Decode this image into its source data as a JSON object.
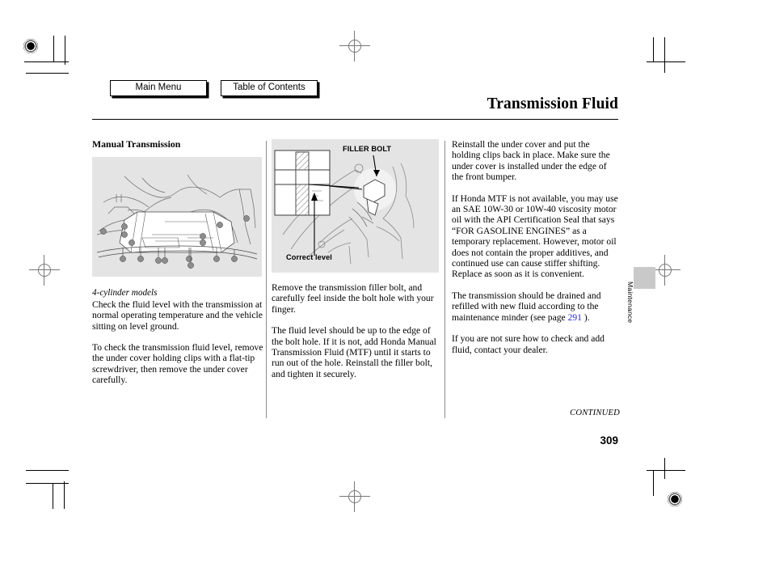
{
  "nav": {
    "main_menu": "Main Menu",
    "table_of_contents": "Table of Contents"
  },
  "header": {
    "title": "Transmission Fluid"
  },
  "left_column": {
    "heading": "Manual Transmission",
    "figure_alt": "under cover with holding clips",
    "caption": "4-cylinder models",
    "paragraph_1": "Check the fluid level with the transmission at normal operating temperature and the vehicle sitting on level ground.",
    "paragraph_2": "To check the transmission fluid level, remove the under cover holding clips with a flat-tip screwdriver, then remove the under cover carefully."
  },
  "middle_column": {
    "figure_label_filler_bolt": "FILLER BOLT",
    "figure_label_correct_level": "Correct level",
    "paragraph_1": "Remove the transmission filler bolt, and carefully feel inside the bolt hole with your finger.",
    "paragraph_2": "The fluid level should be up to the edge of the bolt hole. If it is not, add Honda Manual Transmission Fluid (MTF) until it starts to run out of the hole. Reinstall the filler bolt, and tighten it securely."
  },
  "right_column": {
    "paragraph_1": "Reinstall the under cover and put the holding clips back in place. Make sure the under cover is installed under the edge of the front bumper.",
    "paragraph_2": "If Honda MTF is not available, you may use an SAE 10W-30 or 10W-40 viscosity motor oil with the API Certification Seal that says “FOR GASOLINE ENGINES” as a temporary replacement. However, motor oil does not contain the proper additives, and continued use can cause stiffer shifting. Replace as soon as it is convenient.",
    "paragraph_3_before_link": "The transmission should be drained and refilled with new fluid according to the maintenance minder (see page ",
    "paragraph_3_link": "291",
    "paragraph_3_after_link": " ).",
    "paragraph_4": "If you are not sure how to check and add fluid, contact your dealer."
  },
  "side_tab": {
    "label": "Maintenance"
  },
  "footer": {
    "continued": "CONTINUED",
    "page_number": "309"
  },
  "colors": {
    "link": "#2a2ac8",
    "figure_background": "#e4e4e4",
    "side_tab": "#c9c9c9"
  }
}
